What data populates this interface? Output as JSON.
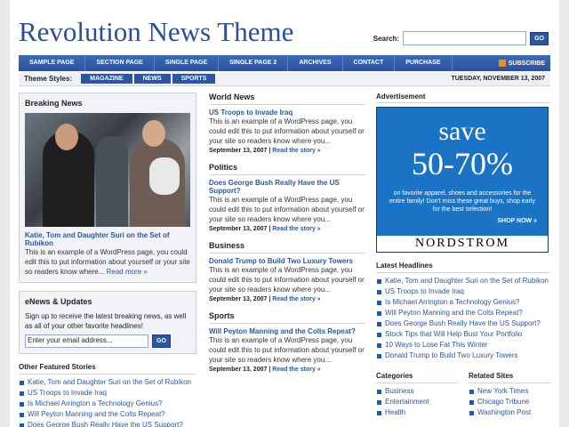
{
  "header": {
    "site_title": "Revolution News Theme",
    "search_label": "Search:",
    "search_placeholder": "",
    "search_button": "GO"
  },
  "nav": {
    "items": [
      "Sample Page",
      "Section Page",
      "Single Page",
      "Single Page 2",
      "Archives",
      "Contact",
      "Purchase"
    ],
    "subscribe_label": "Subscribe"
  },
  "styles_bar": {
    "label": "Theme Styles:",
    "buttons": [
      "Magazine",
      "News",
      "Sports"
    ],
    "date": "TUESDAY, NOVEMBER 13, 2007"
  },
  "breaking": {
    "title": "Breaking News",
    "story_head": "Katie, Tom and Daughter Suri on the Set of Rubikon",
    "story_text": "This is an example of a WordPress page, you could edit this to put information about yourself or your site so readers know where...",
    "read_more": "Read more »"
  },
  "enews": {
    "title": "eNews & Updates",
    "text": "Sign up to receive the latest breaking news, as well as all of your other favorite headlines!",
    "input_placeholder": "Enter your email address...",
    "button": "GO"
  },
  "other": {
    "title": "Other Featured Stories",
    "items": [
      "Katie, Tom and Daughter Suri on the Set of Rubikon",
      "US Troops to Invade Iraq",
      "Is Michael Arrington a Technology Genius?",
      "Will Peyton Manning and the Colts Repeat?",
      "Does George Bush Really Have the US Support?"
    ]
  },
  "sections": [
    {
      "title": "World News",
      "head": "US Troops to Invade Iraq",
      "text": "This is an example of a WordPress page, you could edit this to put information about yourself or your site so readers know where you...",
      "date": "September 13, 2007",
      "read": "Read the story »"
    },
    {
      "title": "Politics",
      "head": "Does George Bush Really Have the US Support?",
      "text": "This is an example of a WordPress page, you could edit this to put information about yourself or your site so readers know where you...",
      "date": "September 13, 2007",
      "read": "Read the story »"
    },
    {
      "title": "Business",
      "head": "Donald Trump to Build Two Luxury Towers",
      "text": "This is an example of a WordPress page, you could edit this to put information about yourself or your site so readers know where you...",
      "date": "September 13, 2007",
      "read": "Read the story »"
    },
    {
      "title": "Sports",
      "head": "Will Peyton Manning and the Colts Repeat?",
      "text": "This is an example of a WordPress page, you could edit this to put information about yourself or your site so readers know where you...",
      "date": "September 13, 2007",
      "read": "Read the story »"
    }
  ],
  "ad": {
    "title": "Advertisement",
    "save": "save",
    "percent": "50-70%",
    "text": "on favorite apparel, shoes and accessories for the entire family! Don't miss these great buys, shop early for the best selection!",
    "shop": "SHOP NOW »",
    "brand": "NORDSTROM"
  },
  "latest": {
    "title": "Latest Headlines",
    "items": [
      "Katie, Tom and Daughter Suri on the Set of Rubikon",
      "US Troops to Invade Iraq",
      "Is Michael Arrington a Technology Genius?",
      "Will Peyton Manning and the Colts Repeat?",
      "Does George Bush Really Have the US Support?",
      "Stock Tips that Will Help Bust Your Portfolio",
      "10 Ways to Lose Fat This Winter",
      "Donald Trump to Build Two Luxury Towers"
    ]
  },
  "categories": {
    "title": "Categories",
    "items": [
      "Business",
      "Entertainment",
      "Health"
    ]
  },
  "related": {
    "title": "Related Sites",
    "items": [
      "New York Times",
      "Chicago Tribune",
      "Washington Post"
    ]
  },
  "colors": {
    "brand": "#2a4f96",
    "link": "#2a56a4",
    "ad_bg": "#1a73c4"
  }
}
